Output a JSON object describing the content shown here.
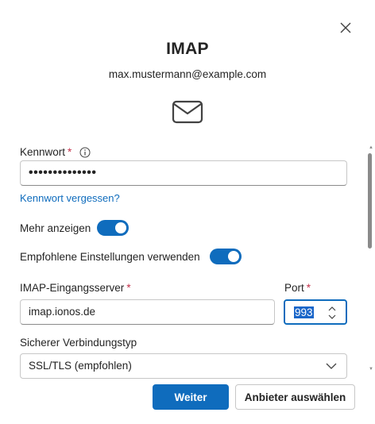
{
  "dialog": {
    "title": "IMAP",
    "account_email": "max.mustermann@example.com"
  },
  "password": {
    "label": "Kennwort",
    "required_marker": "*",
    "value_masked": "••••••••••••••",
    "forgot_link": "Kennwort vergessen?"
  },
  "toggles": {
    "show_more_label": "Mehr anzeigen",
    "show_more_on": true,
    "recommended_label": "Empfohlene Einstellungen verwenden",
    "recommended_on": true
  },
  "server": {
    "incoming_label": "IMAP-Eingangsserver",
    "incoming_value": "imap.ionos.de",
    "required_marker": "*",
    "port_label": "Port",
    "port_value": "993"
  },
  "security": {
    "label": "Sicherer Verbindungstyp",
    "selected": "SSL/TLS (empfohlen)"
  },
  "footer": {
    "next_label": "Weiter",
    "choose_provider_label": "Anbieter auswählen"
  },
  "colors": {
    "accent": "#0f6cbd",
    "required": "#c4314b",
    "text": "#242424"
  }
}
